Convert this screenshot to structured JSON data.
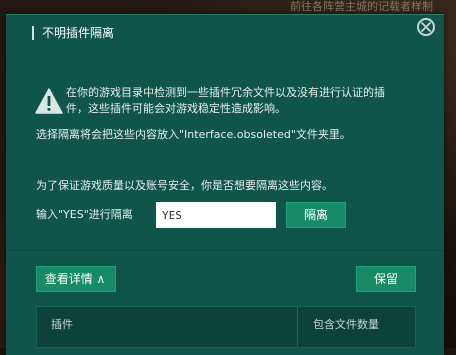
{
  "background": {
    "text": "前往各阵营主城的记载者样制"
  },
  "dialog": {
    "title": "不明插件隔离",
    "close_icon": "close-icon",
    "warning_icon": "warning-triangle-icon",
    "message_line1": "在你的游戏目录中检测到一些插件冗余文件以及没有进行认证的插",
    "message_line2": "件，这些插件可能会对游戏稳定性造成影响。",
    "message_line3": "选择隔离将会把这些内容放入\"Interface.obsoleted\"文件夹里。",
    "question": "为了保证游戏质量以及账号安全，你是否想要隔离这些内容。",
    "input_label": "输入\"YES\"进行隔离",
    "input_value": "YES",
    "quarantine_button": "隔离",
    "details_button": "查看详情 ∧",
    "keep_button": "保留",
    "table": {
      "columns": [
        "插件",
        "包含文件数量"
      ]
    },
    "colors": {
      "panel": "#0f5549",
      "button": "#178a66",
      "accent_text": "#ffffff"
    }
  }
}
